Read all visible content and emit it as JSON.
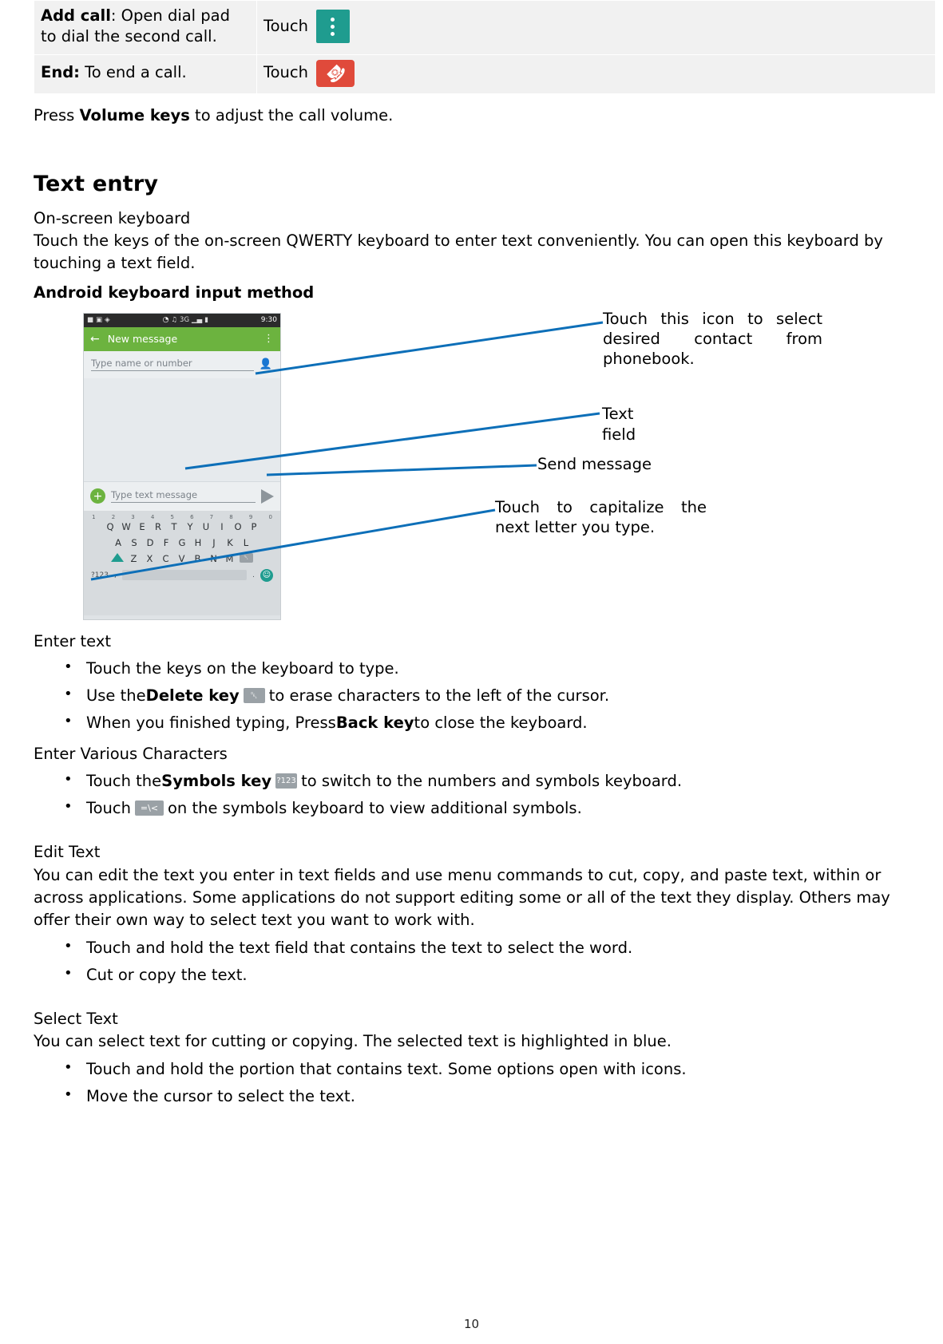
{
  "table": {
    "rows": [
      {
        "label_bold": "Add call",
        "label_rest": ": Open dial pad to dial the second call.",
        "action_prefix": "Touch",
        "action_icon": "dialpad-more-icon"
      },
      {
        "label_bold": "End:",
        "label_rest": " To end a call.",
        "action_prefix": "Touch",
        "action_icon": "end-call-icon"
      }
    ]
  },
  "volume_note": {
    "pre": "Press ",
    "bold": "Volume keys",
    "post": " to adjust the call volume."
  },
  "text_entry": {
    "heading": "Text entry",
    "line1": "On-screen keyboard",
    "line2": "Touch the keys of the on-screen QWERTY keyboard to enter text conveniently. You can open this keyboard by touching a text field.",
    "subheading": "Android keyboard input method"
  },
  "phone": {
    "status_time": "9:30",
    "status_icons": "3G",
    "title": "New message",
    "recipient_placeholder": "Type name or number",
    "compose_placeholder": "Type text message",
    "keyboard": {
      "numbers": [
        "1",
        "2",
        "3",
        "4",
        "5",
        "6",
        "7",
        "8",
        "9",
        "0"
      ],
      "row1": [
        "Q",
        "W",
        "E",
        "R",
        "T",
        "Y",
        "U",
        "I",
        "O",
        "P"
      ],
      "row2": [
        "A",
        "S",
        "D",
        "F",
        "G",
        "H",
        "J",
        "K",
        "L"
      ],
      "row3": [
        "Z",
        "X",
        "C",
        "V",
        "B",
        "N",
        "M"
      ],
      "sym_key": "?123",
      "comma": ",",
      "period": "."
    }
  },
  "callouts": {
    "contact": "Touch this icon to select desired contact from phonebook.",
    "textfield_line1": "Text",
    "textfield_line2": "field",
    "send": "Send message",
    "capitalize": "Touch to capitalize the next letter you type."
  },
  "enter_text": {
    "title": "Enter text",
    "items": [
      {
        "pre": "Touch the keys on the keyboard to type.",
        "bold": "",
        "post": "",
        "icon": ""
      },
      {
        "pre": "Use the ",
        "bold": "Delete key",
        "icon": "delete-key-icon",
        "post": " to erase characters to the left of the cursor."
      },
      {
        "pre": "When you finished typing, Press ",
        "bold": "Back key",
        "icon": "",
        "post": " to close the keyboard."
      }
    ]
  },
  "various_chars": {
    "title": "Enter Various Characters",
    "items": [
      {
        "pre": "Touch the ",
        "bold": "Symbols key",
        "icon": "symbols-key-icon",
        "post": " to switch to the numbers and symbols keyboard."
      },
      {
        "pre": "Touch ",
        "bold": "",
        "icon": "backslash-key-icon",
        "post": " on the symbols keyboard to view additional symbols."
      }
    ]
  },
  "edit_text": {
    "title": "Edit Text",
    "paragraph": "You can edit the text you enter in text fields and use menu commands to cut, copy, and paste text, within or across applications. Some applications do not support editing some or all of the text they display. Others may offer their own way to select text you want to work with.",
    "items": [
      "Touch and hold the text field that contains the text to select the word.",
      "Cut or copy the text."
    ]
  },
  "select_text": {
    "title": "Select Text",
    "paragraph": "You can select text for cutting or copying. The selected text is highlighted in blue.",
    "items": [
      "Touch and hold the portion that contains text. Some options open with icons.",
      "Move the cursor to select the text."
    ]
  },
  "page_number": "10",
  "colors": {
    "accent_teal": "#1f9c8f",
    "end_red": "#e04a3b",
    "app_green": "#6cb33f",
    "leader_blue": "#0d6fb8"
  }
}
